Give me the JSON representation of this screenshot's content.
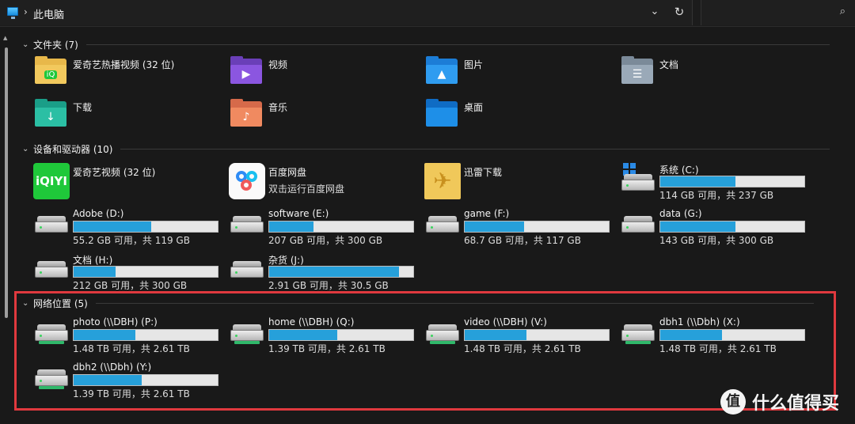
{
  "address": {
    "breadcrumb_sep": "›",
    "location": "此电脑",
    "dropdown_glyph": "⌄",
    "refresh_glyph": "↻",
    "search_glyph": "⌕"
  },
  "groups": {
    "folders": {
      "label": "文件夹 (7)"
    },
    "devices": {
      "label": "设备和驱动器 (10)"
    },
    "network": {
      "label": "网络位置 (5)"
    }
  },
  "folders": [
    {
      "name": "爱奇艺热播视频 (32 位)",
      "icon": "iqiyi-folder-icon"
    },
    {
      "name": "视频",
      "icon": "videos-folder-icon"
    },
    {
      "name": "图片",
      "icon": "pictures-folder-icon"
    },
    {
      "name": "文档",
      "icon": "documents-folder-icon"
    },
    {
      "name": "下载",
      "icon": "downloads-folder-icon"
    },
    {
      "name": "音乐",
      "icon": "music-folder-icon"
    },
    {
      "name": "桌面",
      "icon": "desktop-folder-icon"
    }
  ],
  "apps": [
    {
      "name": "爱奇艺视频 (32 位)",
      "sub": ""
    },
    {
      "name": "百度网盘",
      "sub": "双击运行百度网盘"
    },
    {
      "name": "迅雷下载",
      "sub": ""
    }
  ],
  "drives": [
    {
      "name": "系统 (C:)",
      "space": "114 GB 可用，共 237 GB",
      "used_fraction": 0.52
    },
    {
      "name": "Adobe (D:)",
      "space": "55.2 GB 可用，共 119 GB",
      "used_fraction": 0.54
    },
    {
      "name": "software (E:)",
      "space": "207 GB 可用，共 300 GB",
      "used_fraction": 0.31
    },
    {
      "name": "game (F:)",
      "space": "68.7 GB 可用，共 117 GB",
      "used_fraction": 0.41
    },
    {
      "name": "data (G:)",
      "space": "143 GB 可用，共 300 GB",
      "used_fraction": 0.52
    },
    {
      "name": "文档 (H:)",
      "space": "212 GB 可用，共 300 GB",
      "used_fraction": 0.29
    },
    {
      "name": "杂货 (J:)",
      "space": "2.91 GB 可用，共 30.5 GB",
      "used_fraction": 0.9
    }
  ],
  "network": [
    {
      "name": "photo (\\\\DBH) (P:)",
      "space": "1.48 TB 可用，共 2.61 TB",
      "used_fraction": 0.43
    },
    {
      "name": "home (\\\\DBH) (Q:)",
      "space": "1.39 TB 可用，共 2.61 TB",
      "used_fraction": 0.47
    },
    {
      "name": "video (\\\\DBH) (V:)",
      "space": "1.48 TB 可用，共 2.61 TB",
      "used_fraction": 0.43
    },
    {
      "name": "dbh1 (\\\\Dbh) (X:)",
      "space": "1.48 TB 可用，共 2.61 TB",
      "used_fraction": 0.43
    },
    {
      "name": "dbh2 (\\\\Dbh) (Y:)",
      "space": "1.39 TB 可用，共 2.61 TB",
      "used_fraction": 0.47
    }
  ],
  "colors": {
    "accent": "#26a0da",
    "highlight_box": "#e0393e",
    "background": "#191919"
  },
  "watermark": {
    "logo": "值",
    "text": "什么值得买"
  }
}
